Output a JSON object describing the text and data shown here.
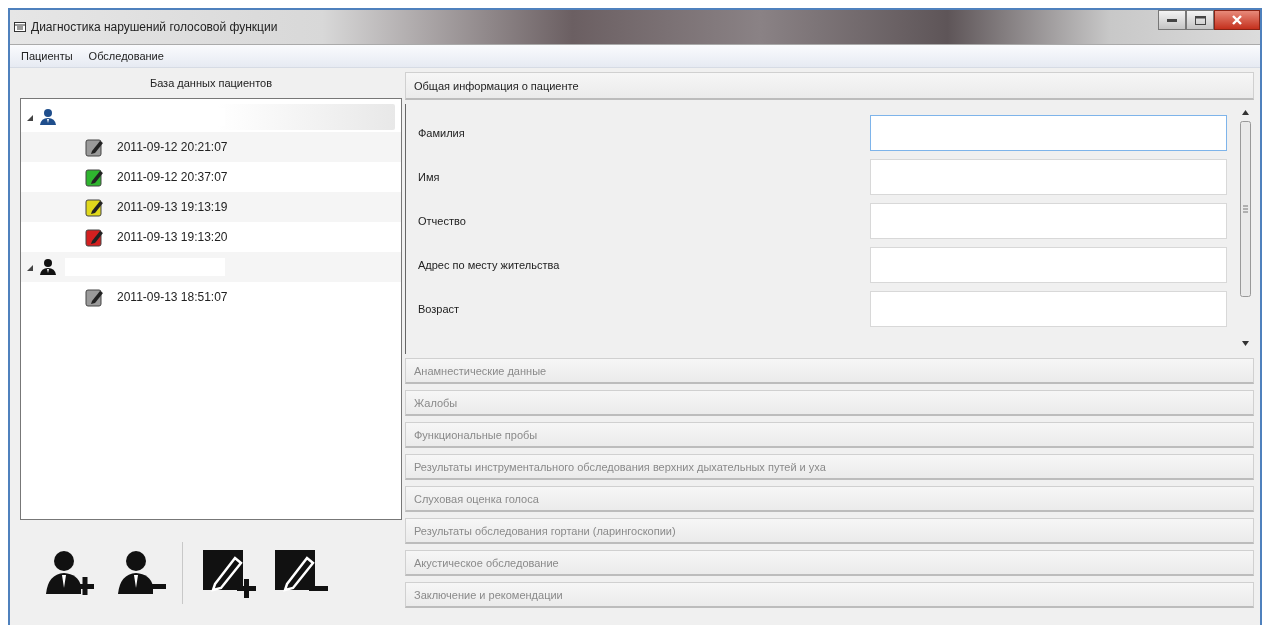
{
  "window": {
    "title": "Диагностика нарушений голосовой функции"
  },
  "menu": [
    {
      "label": "Пациенты"
    },
    {
      "label": "Обследование"
    }
  ],
  "patients_panel": {
    "title": "База данных пациентов",
    "patients": [
      {
        "selected": true,
        "expanded": true,
        "children": [
          {
            "date": "2011-09-12 20:21:07",
            "color": "#9a9a9a"
          },
          {
            "date": "2011-09-12 20:37:07",
            "color": "#2fb52f"
          },
          {
            "date": "2011-09-13 19:13:19",
            "color": "#e0d81c"
          },
          {
            "date": "2011-09-13 19:13:20",
            "color": "#d42020"
          }
        ]
      },
      {
        "selected": false,
        "expanded": true,
        "children": [
          {
            "date": "2011-09-13 18:51:07",
            "color": "#9a9a9a"
          }
        ]
      }
    ]
  },
  "sections": [
    {
      "title": "Общая информация о пациенте",
      "expanded": true,
      "fields": [
        {
          "label": "Фамилия",
          "focused": true
        },
        {
          "label": "Имя",
          "focused": false
        },
        {
          "label": "Отчество",
          "focused": false
        },
        {
          "label": "Адрес по месту жительства",
          "focused": false
        },
        {
          "label": "Возраст",
          "focused": false
        }
      ]
    },
    {
      "title": "Анамнестические данные",
      "expanded": false
    },
    {
      "title": "Жалобы",
      "expanded": false
    },
    {
      "title": "Функциональные пробы",
      "expanded": false
    },
    {
      "title": "Результаты инструментального обследования верхних дыхательных путей и уха",
      "expanded": false
    },
    {
      "title": "Слуховая оценка голоса",
      "expanded": false
    },
    {
      "title": "Результаты обследования гортани (ларингоскопии)",
      "expanded": false
    },
    {
      "title": "Акустическое обследование",
      "expanded": false
    },
    {
      "title": "Заключение и рекомендации",
      "expanded": false
    }
  ]
}
